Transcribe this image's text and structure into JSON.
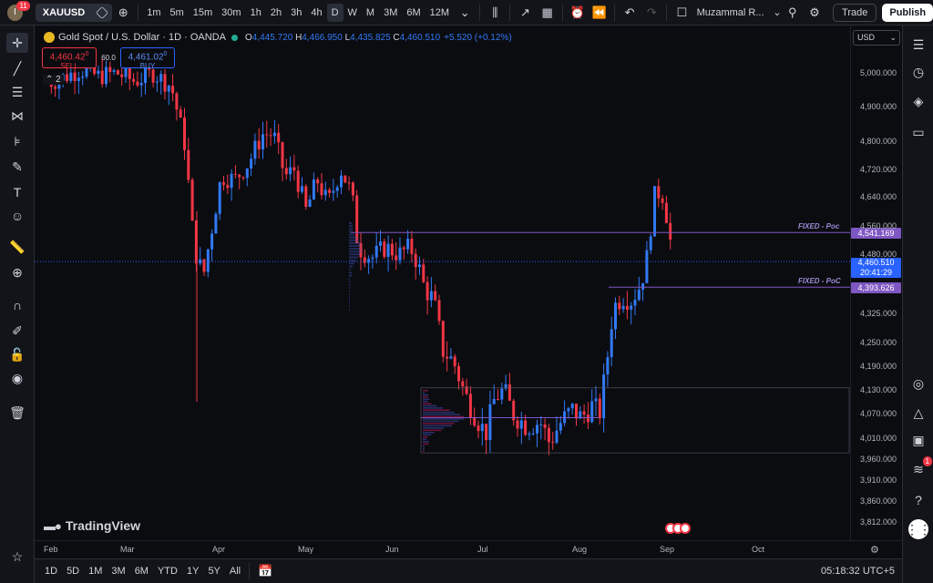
{
  "topbar": {
    "avatar_letter": "I",
    "notifications": "11",
    "symbol": "XAUUSD",
    "intervals": [
      "1m",
      "5m",
      "15m",
      "30m",
      "1h",
      "2h",
      "3h",
      "4h",
      "D",
      "W",
      "M",
      "3M",
      "6M",
      "12M"
    ],
    "active_interval": "D",
    "user": "Muzammal R...",
    "trade_label": "Trade",
    "publish_label": "Publish"
  },
  "legend": {
    "title": "Gold Spot / U.S. Dollar · 1D · OANDA",
    "o_label": "O",
    "o": "4,445.720",
    "h_label": "H",
    "h": "4,466.950",
    "l_label": "L",
    "l": "4,435.825",
    "c_label": "C",
    "c": "4,460.510",
    "change": "+5.520 (+0.12%)"
  },
  "order": {
    "sell_price": "4,460.42",
    "sell_sup": "0",
    "sell_label": "SELL",
    "spread": "60.0",
    "buy_price": "4,461.02",
    "buy_sup": "0",
    "buy_label": "BUY"
  },
  "collapse_count": "2",
  "currency": "USD",
  "price_axis": [
    "5,000.000",
    "4,900.000",
    "4,800.000",
    "4,720.000",
    "4,640.000",
    "4,560.000",
    "4,480.000",
    "4,325.000",
    "4,250.000",
    "4,190.000",
    "4,130.000",
    "4,070.000",
    "4,010.000",
    "3,960.000",
    "3,910.000",
    "3,860.000",
    "3,812.000"
  ],
  "price_labels": {
    "poc_upper": "4,541.169",
    "last": "4,460.510",
    "countdown": "20:41:29",
    "poc_lower": "4,393.626"
  },
  "fixed_upper": "FIXED - Poc",
  "fixed_lower": "FIXED - PoC",
  "time_axis": [
    "Feb",
    "Mar",
    "Apr",
    "May",
    "Jun",
    "Jul",
    "Aug",
    "Sep",
    "Oct"
  ],
  "watermark": "TradingView",
  "ranges": [
    "1D",
    "5D",
    "1M",
    "3M",
    "6M",
    "YTD",
    "1Y",
    "5Y",
    "All"
  ],
  "clock": "05:18:32 UTC+5",
  "colors": {
    "up": "#3179f5",
    "down": "#f23645",
    "poc_line": "#7e57c2",
    "bg": "#0b0c10"
  },
  "chart_data": {
    "type": "candlestick",
    "title": "Gold Spot / U.S. Dollar · 1D · OANDA",
    "ylim": [
      3790,
      5060
    ],
    "x": [
      "Feb",
      "Mar",
      "Apr",
      "May",
      "Jun",
      "Jul",
      "Aug",
      "Sep"
    ],
    "close": [
      4980,
      4960,
      4700,
      4600,
      4550,
      4500,
      4460,
      4180,
      4050,
      4000,
      4060,
      4070,
      4400,
      4700,
      4460
    ],
    "series": [
      {
        "name": "Volume profile POC",
        "values": [
          4541.169,
          4393.626
        ]
      }
    ]
  }
}
